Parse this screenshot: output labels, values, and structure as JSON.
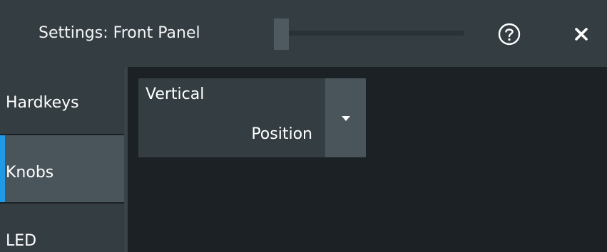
{
  "dialog": {
    "title": "Settings: Front Panel",
    "help_icon": "help-circle-icon",
    "close_icon": "close-icon"
  },
  "sidebar": {
    "items": [
      {
        "label": "Hardkeys",
        "active": false
      },
      {
        "label": "Knobs",
        "active": true
      },
      {
        "label": "LED",
        "active": false
      }
    ]
  },
  "knob_function": {
    "line1": "Vertical",
    "line2": "Position",
    "arrow_icon": "caret-down-icon"
  },
  "colors": {
    "titlebar": "#343d42",
    "content_bg": "#1c2125",
    "active_item": "#4a555b",
    "accent": "#1f9ae6"
  }
}
